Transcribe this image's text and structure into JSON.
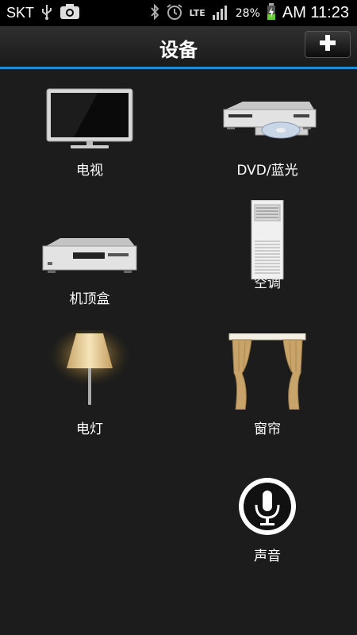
{
  "status_bar": {
    "carrier": "SKT",
    "battery_percent": "28%",
    "time": "AM 11:23",
    "network": "LTE",
    "icons": [
      "usb-icon",
      "image-icon",
      "bluetooth-icon",
      "alarm-icon",
      "lte-icon",
      "signal-icon",
      "battery-charging-icon"
    ]
  },
  "header": {
    "title": "设备",
    "add_icon": "plus-icon"
  },
  "devices": [
    {
      "label": "电视",
      "icon": "tv-icon"
    },
    {
      "label": "DVD/蓝光",
      "icon": "dvd-player-icon"
    },
    {
      "label": "机顶盒",
      "icon": "set-top-box-icon"
    },
    {
      "label": "空调",
      "icon": "air-conditioner-icon"
    },
    {
      "label": "电灯",
      "icon": "lamp-icon"
    },
    {
      "label": "窗帘",
      "icon": "curtain-icon"
    },
    {
      "label": "声音",
      "icon": "microphone-icon"
    }
  ],
  "colors": {
    "accent": "#1a8fd6",
    "background": "#1c1c1c"
  }
}
